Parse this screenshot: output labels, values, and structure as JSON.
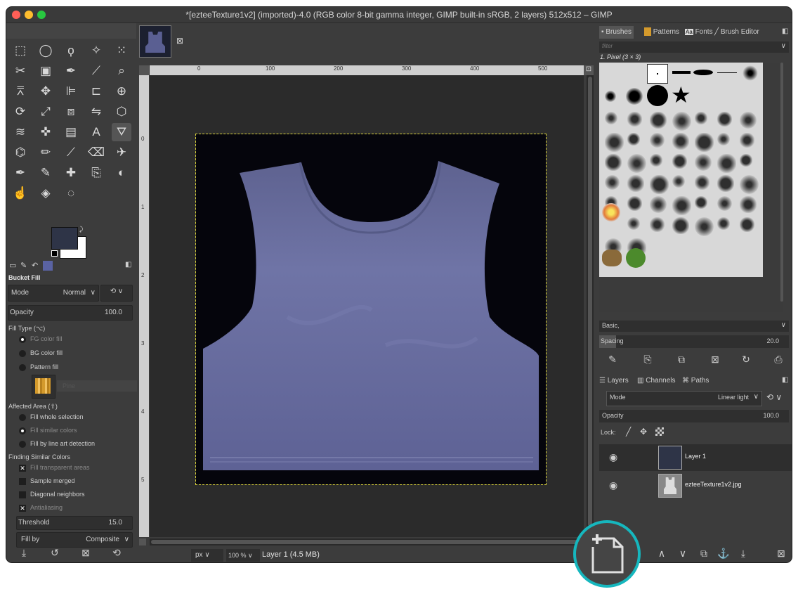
{
  "window": {
    "title": "*[ezteeTexture1v2] (imported)-4.0 (RGB color 8-bit gamma integer, GIMP built-in sRGB, 2 layers) 512x512 – GIMP"
  },
  "colors": {
    "bg": "#3c3c3c",
    "canvas": "#2b2b2b",
    "shirt": "#6a6e9c",
    "fg": "#2e3447",
    "bg_color": "#ffffff",
    "highlight": "#16b7be"
  },
  "tools": [
    "rect-select",
    "ellipse-select",
    "free-select",
    "fuzzy-select",
    "by-color-select",
    "scissors",
    "foreground-select",
    "paths",
    "color-picker",
    "zoom",
    "measure",
    "move",
    "align",
    "crop",
    "unified-transform",
    "rotate",
    "scale",
    "perspective",
    "flip",
    "cage-transform",
    "warp",
    "handle-transform",
    "gradient",
    "text",
    "bucket-fill",
    "blend",
    "pencil",
    "paintbrush",
    "eraser",
    "airbrush",
    "ink",
    "mypaint-brush",
    "heal",
    "clone",
    "dodge-burn",
    "smudge",
    "blur",
    "convolve"
  ],
  "tool_options": {
    "title": "Bucket Fill",
    "mode_label": "Mode",
    "mode_value": "Normal",
    "opacity_label": "Opacity",
    "opacity_value": "100.0",
    "fill_type_label": "Fill Type  (⌥)",
    "fill_types": [
      "FG color fill",
      "BG color fill",
      "Pattern fill"
    ],
    "pattern_name": "Pine",
    "affected_area_label": "Affected Area  (⇧)",
    "affected_areas": [
      "Fill whole selection",
      "Fill similar colors",
      "Fill by line art detection"
    ],
    "finding_label": "Finding Similar Colors",
    "finding_options": [
      "Fill transparent areas",
      "Sample merged",
      "Diagonal neighbors",
      "Antialiasing"
    ],
    "threshold_label": "Threshold",
    "threshold_value": "15.0",
    "fill_by_label": "Fill by",
    "fill_by_value": "Composite"
  },
  "ruler": {
    "ticks": [
      "0",
      "100",
      "200",
      "300",
      "400",
      "500"
    ],
    "left_ticks": [
      "0",
      "1",
      "2",
      "3",
      "4",
      "5"
    ]
  },
  "statusbar": {
    "unit": "px",
    "zoom": "100 %",
    "layer_info": "Layer 1 (4.5 MB)"
  },
  "brushes_panel": {
    "tabs": [
      "Brushes",
      "Patterns",
      "Fonts",
      "Brush Editor"
    ],
    "filter_placeholder": "filter",
    "selected_brush": "1. Pixel (3 × 3)",
    "tag": "Basic,",
    "spacing_label": "Spacing",
    "spacing_value": "20.0"
  },
  "layers_panel": {
    "tabs": [
      "Layers",
      "Channels",
      "Paths"
    ],
    "mode_label": "Mode",
    "mode_value": "Linear light",
    "opacity_label": "Opacity",
    "opacity_value": "100.0",
    "lock_label": "Lock:",
    "layers": [
      {
        "name": "Layer 1"
      },
      {
        "name": "ezteeTexture1v2.jpg"
      }
    ]
  }
}
